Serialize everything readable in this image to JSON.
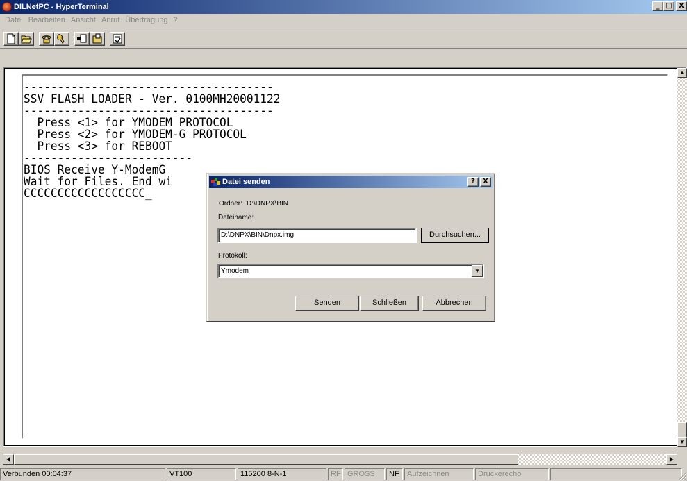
{
  "window": {
    "title": "DILNetPC - HyperTerminal",
    "min_label": "_",
    "max_label": "□",
    "close_label": "X"
  },
  "menu": [
    {
      "label": "Datei"
    },
    {
      "label": "Bearbeiten"
    },
    {
      "label": "Ansicht"
    },
    {
      "label": "Anruf"
    },
    {
      "label": "Übertragung"
    },
    {
      "label": "?"
    }
  ],
  "toolbar": {
    "icons": [
      "new-icon",
      "open-icon",
      "connect-icon",
      "disconnect-icon",
      "send-icon",
      "receive-icon",
      "properties-icon"
    ]
  },
  "terminal": {
    "lines": [
      "-------------------------------------",
      "SSV FLASH LOADER - Ver. 0100MH20001122",
      "-------------------------------------",
      "  Press <1> for YMODEM PROTOCOL",
      "  Press <2> for YMODEM-G PROTOCOL",
      "  Press <3> for REBOOT",
      "-------------------------",
      "",
      "BIOS Receive Y-ModemG",
      "Wait for Files. End wi",
      "CCCCCCCCCCCCCCCCCC_"
    ]
  },
  "dialog": {
    "title": "Datei senden",
    "help_label": "?",
    "close_label": "X",
    "folder_label": "Ordner:",
    "folder_value": "D:\\DNPX\\BIN",
    "filename_label": "Dateiname:",
    "filename_value": "D:\\DNPX\\BIN\\Dnpx.img",
    "browse_label": "Durchsuchen...",
    "protocol_label": "Protokoll:",
    "protocol_value": "Ymodem",
    "send_label": "Senden",
    "close_button_label": "Schließen",
    "cancel_label": "Abbrechen"
  },
  "status": {
    "connected": "Verbunden 00:04:37",
    "emulation": "VT100",
    "port_settings": "115200 8-N-1",
    "rf": "RF",
    "caps": "GROSS",
    "num": "NF",
    "capture": "Aufzeichnen",
    "print_echo": "Druckerecho"
  }
}
